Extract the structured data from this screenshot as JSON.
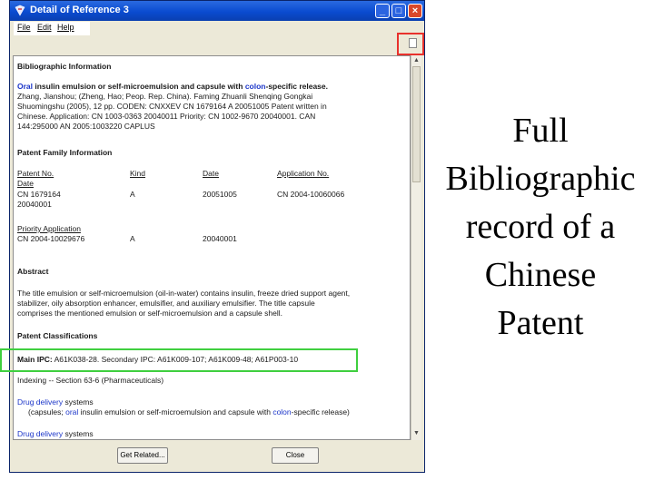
{
  "window": {
    "title": "Detail of Reference 3"
  },
  "menu": [
    "File",
    "Edit",
    "Help"
  ],
  "icons": {
    "app": "app-icon",
    "doc": "document-icon"
  },
  "bibliographic": {
    "heading": "Bibliographic Information",
    "title_oral": "Oral",
    "title_mid": " insulin emulsion or self-microemulsion and capsule with ",
    "title_colon": "colon",
    "title_end": "-specific release.",
    "line2": "Zhang, Jianshou; (Zheng, Hao; Peop. Rep. China). Faming Zhuanli Shenqing Gongkai",
    "line3": "Shuomingshu (2005), 12 pp. CODEN: CNXXEV CN 1679164 A 20051005 Patent written in",
    "line4": "Chinese. Application: CN 1003-0363 20040011 Priority: CN 1002-9670 20040001. CAN",
    "line5": "144:295000 AN 2005:1003220 CAPLUS"
  },
  "patent_family": {
    "heading": "Patent Family Information",
    "headers": [
      "Patent No.",
      "Kind",
      "Date",
      "Application No."
    ],
    "header_date2": "Date",
    "row": [
      "CN 1679164",
      "A",
      "20051005",
      "CN 2004-10060066"
    ],
    "row_date2": "20040001",
    "priority_heading": "Priority Application",
    "priority_row": [
      "CN 2004-10029676",
      "A",
      "20040001"
    ]
  },
  "abstract": {
    "heading": "Abstract",
    "lines": [
      "The title emulsion or self-microemulsion (oil-in-water) contains insulin, freeze dried support agent,",
      "stabilizer, oily absorption enhancer, emulsifier, and auxiliary emulsifier. The title capsule",
      "comprises the mentioned emulsion or self-microemulsion and a capsule shell."
    ]
  },
  "classifications": {
    "heading": "Patent Classifications",
    "main_label": "Main IPC:",
    "main_value": " A61K038-28. Secondary IPC: A61K009-107; A61K009-48; A61P003-10",
    "indexing": "Indexing -- Section 63-6 (Pharmaceuticals)"
  },
  "indexing_entries": {
    "drug_word": "Drug delivery",
    "systems": " systems",
    "sub_prefix": "(capsules; ",
    "sub_oral": "oral",
    "sub_mid": " insulin emulsion or self-microemulsion and capsule with ",
    "sub_colon": "colon",
    "sub_end": "-specific release)",
    "drug_word2": "Drug delivery",
    "systems2": " systems"
  },
  "buttons": {
    "get_related": "Get Related...",
    "close": "Close"
  },
  "caption": [
    "Full",
    "Bibliographic",
    "record of a",
    "Chinese",
    "Patent"
  ],
  "colors": {
    "highlight_red": "#e8312c",
    "highlight_green": "#3fcf3f",
    "link_blue": "#1b35c9"
  }
}
